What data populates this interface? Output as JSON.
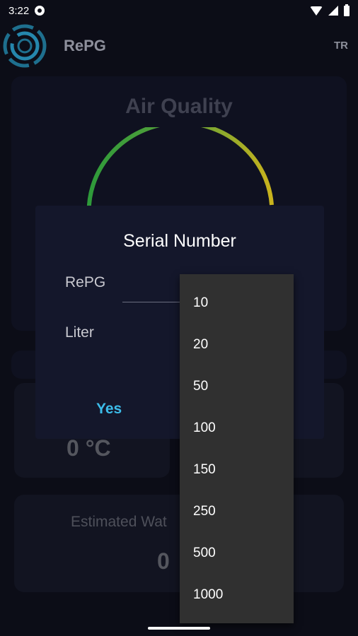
{
  "status_bar": {
    "time": "3:22"
  },
  "app_bar": {
    "title": "RePG",
    "language_button": "TR"
  },
  "background": {
    "air_quality_title": "Air Quality",
    "temperature_value": "0 °C",
    "estimated_water_label": "Estimated Wat",
    "estimated_water_value": "0"
  },
  "dialog": {
    "title": "Serial Number",
    "repg_label": "RePG",
    "liter_label": "Liter",
    "yes_button": "Yes"
  },
  "dropdown": {
    "options": [
      "10",
      "20",
      "50",
      "100",
      "150",
      "250",
      "500",
      "1000"
    ]
  },
  "colors": {
    "accent": "#3cbce9",
    "gauge_start": "#2e9a3a",
    "gauge_end": "#c9b31d",
    "dialog_bg": "#14172b",
    "menu_bg": "#303030"
  },
  "icons": {
    "logo": "repg-swirl-logo",
    "wifi": "wifi-icon",
    "signal": "cell-signal-icon",
    "battery": "battery-icon"
  }
}
